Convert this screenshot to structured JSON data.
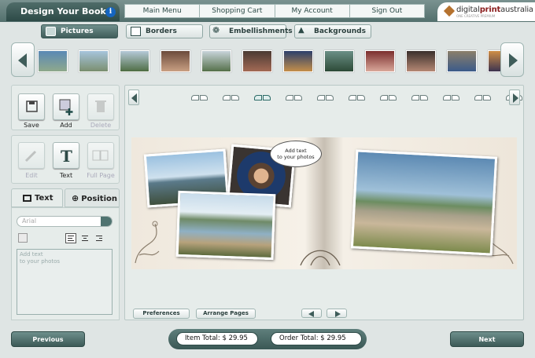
{
  "header": {
    "title": "Design Your Book",
    "menu": [
      "Main Menu",
      "Shopping Cart",
      "My Account",
      "Sign Out"
    ],
    "logo": {
      "prefix": "digital",
      "bold": "print",
      "suffix": "australia",
      "tagline": "ONE CREATIVE PREMIUM"
    }
  },
  "tabs": [
    {
      "label": "Pictures",
      "icon": "picture-icon",
      "active": true
    },
    {
      "label": "Borders",
      "icon": "border-icon",
      "active": false
    },
    {
      "label": "Embellishments",
      "icon": "butterfly-icon",
      "active": false
    },
    {
      "label": "Backgrounds",
      "icon": "mountain-icon",
      "active": false
    }
  ],
  "thumbnails": [
    {
      "colors": [
        "#5a88b5",
        "#8fa98c"
      ]
    },
    {
      "colors": [
        "#a6c4dc",
        "#7a8e6f"
      ]
    },
    {
      "colors": [
        "#b5c9d8",
        "#4f6d44"
      ]
    },
    {
      "colors": [
        "#6b4a3b",
        "#c9a083"
      ]
    },
    {
      "colors": [
        "#c8d4da",
        "#55704a"
      ]
    },
    {
      "colors": [
        "#4a3a33",
        "#a36a55"
      ]
    },
    {
      "colors": [
        "#2c3f6b",
        "#c48f4a"
      ]
    },
    {
      "colors": [
        "#6a8f86",
        "#2d4a37"
      ]
    },
    {
      "colors": [
        "#7b2e2e",
        "#d9a79a"
      ]
    },
    {
      "colors": [
        "#3a2f2c",
        "#b58874"
      ]
    },
    {
      "colors": [
        "#8b7f6a",
        "#3b5b8a"
      ]
    },
    {
      "colors": [
        "#cf8e46",
        "#3d3450"
      ]
    }
  ],
  "tools": {
    "save": "Save",
    "add": "Add",
    "delete": "Delete",
    "edit": "Edit",
    "text": "Text",
    "full_page": "Full Page"
  },
  "panel_tabs": {
    "text": "Text",
    "position": "Position"
  },
  "text_panel": {
    "font": "Arial",
    "placeholder": "Add text\nto your photos"
  },
  "canvas": {
    "bubble_text": "Add text\nto your photos"
  },
  "bottom": {
    "preferences": "Preferences",
    "arrange_pages": "Arrange Pages"
  },
  "footer": {
    "previous": "Previous",
    "next": "Next",
    "item_total": "Item Total:  $ 29.95",
    "order_total": "Order Total:  $ 29.95"
  },
  "colors": {
    "accent": "#4f6d6a",
    "background": "#dfe5e4"
  }
}
